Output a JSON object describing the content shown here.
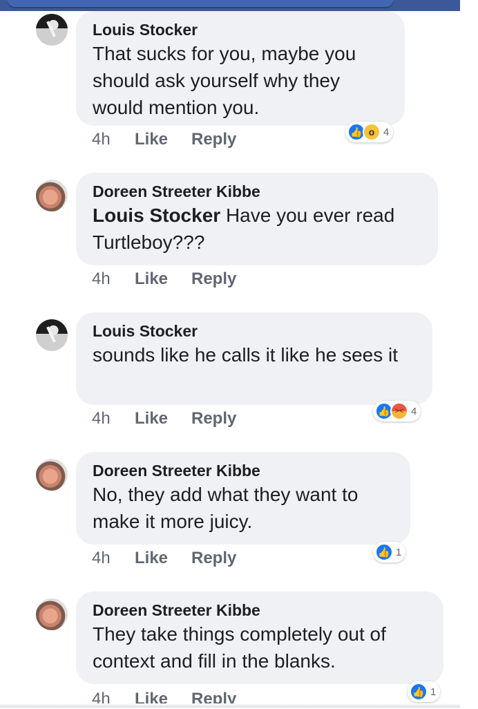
{
  "comments": [
    {
      "author": "Louis Stocker",
      "mention": "",
      "text": "That sucks for you, maybe you should ask yourself why they would mention you.",
      "time": "4h",
      "like": "Like",
      "reply": "Reply",
      "reactions": [
        "like-icon",
        "wow-icon"
      ],
      "reaction_count": "4"
    },
    {
      "author": "Doreen Streeter Kibbe",
      "mention": "Louis Stocker",
      "text": "Have you ever read Turtleboy???",
      "time": "4h",
      "like": "Like",
      "reply": "Reply",
      "reactions": [],
      "reaction_count": ""
    },
    {
      "author": "Louis Stocker",
      "mention": "",
      "text": "sounds like he calls it like he sees it",
      "time": "4h",
      "like": "Like",
      "reply": "Reply",
      "reactions": [
        "like-icon",
        "angry-icon"
      ],
      "reaction_count": "4"
    },
    {
      "author": "Doreen Streeter Kibbe",
      "mention": "",
      "text": "No, they add what they want to make it more juicy.",
      "time": "4h",
      "like": "Like",
      "reply": "Reply",
      "reactions": [
        "like-icon"
      ],
      "reaction_count": "1"
    },
    {
      "author": "Doreen Streeter Kibbe",
      "mention": "",
      "text": "They take things completely out of context and fill in the blanks.",
      "time": "4h",
      "like": "Like",
      "reply": "Reply",
      "reactions": [
        "like-icon"
      ],
      "reaction_count": "1"
    }
  ],
  "colors": {
    "bubble": "#eff1f4",
    "link_blue": "#1877f2",
    "meta_gray": "#606770"
  }
}
